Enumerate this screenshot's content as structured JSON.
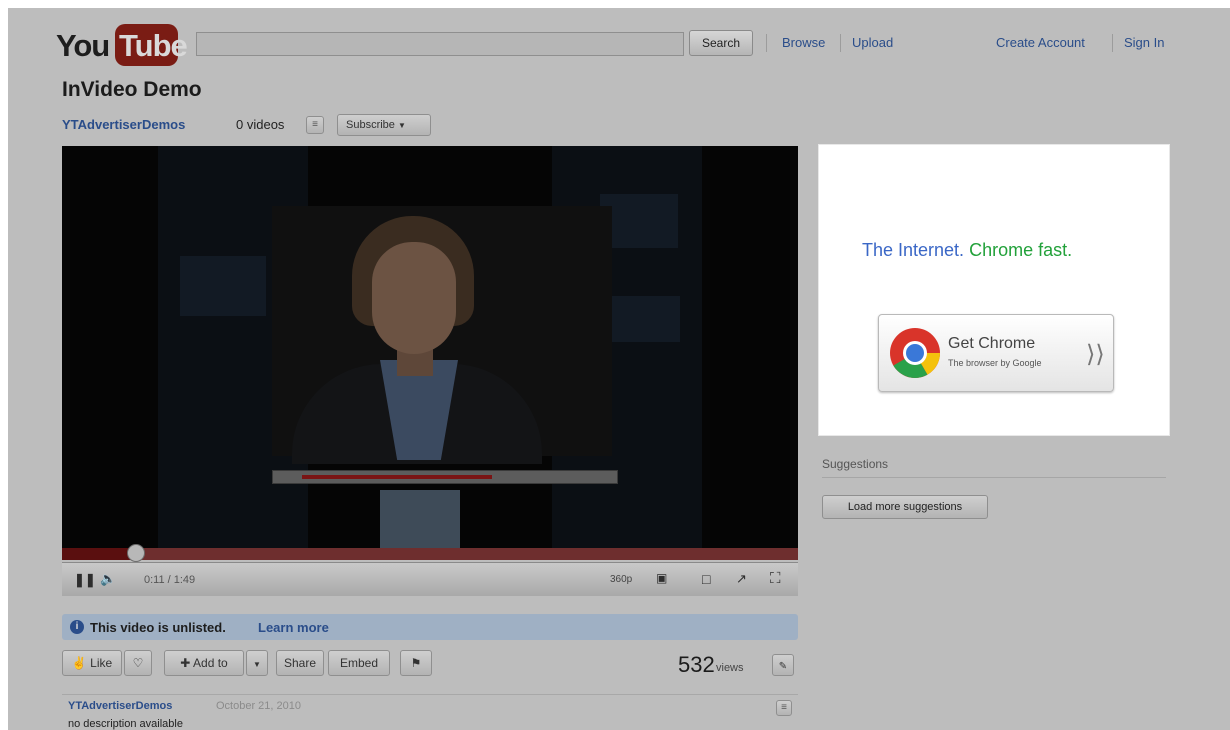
{
  "header": {
    "logo_you": "You",
    "logo_tube": "Tube",
    "search_value": "",
    "search_button": "Search",
    "nav": [
      "Browse",
      "Upload"
    ],
    "account": [
      "Create Account",
      "Sign In"
    ]
  },
  "video": {
    "title": "InVideo Demo",
    "channel": "YTAdvertiserDemos",
    "video_count": "0 videos",
    "subscribe_label": "Subscribe",
    "time": "0:11 / 1:49",
    "progress_fraction": 0.1,
    "quality": "360p"
  },
  "notice": {
    "text": "This video is unlisted.",
    "link": "Learn more"
  },
  "actions": {
    "like": "Like",
    "add_to": "Add to",
    "share": "Share",
    "embed": "Embed",
    "views_number": "532",
    "views_label": "views"
  },
  "description": {
    "channel": "YTAdvertiserDemos",
    "date": "October 21, 2010",
    "text": "no description available"
  },
  "ad": {
    "headline_part1": "The Internet.",
    "headline_part2": "Chrome fast.",
    "button_title": "Get Chrome",
    "button_subtitle": "The browser by Google",
    "colors": {
      "blue": "#3a67c6",
      "green": "#22a13a"
    }
  },
  "sidebar": {
    "suggestions_heading": "Suggestions",
    "load_more": "Load more suggestions"
  }
}
